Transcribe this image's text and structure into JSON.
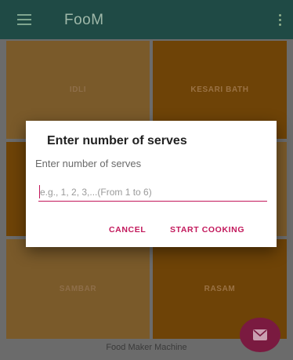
{
  "app_bar": {
    "title": "FooM",
    "menu_icon": "menu-icon",
    "overflow_icon": "overflow-icon"
  },
  "tiles": [
    {
      "label": "IDLI"
    },
    {
      "label": "KESARI BATH"
    },
    {
      "label": ""
    },
    {
      "label": ""
    },
    {
      "label": "SAMBAR"
    },
    {
      "label": "RASAM"
    }
  ],
  "bottom_bar": {
    "label": "Food Maker Machine"
  },
  "fab": {
    "icon": "message-icon"
  },
  "dialog": {
    "title": "Enter number of serves",
    "message": "Enter number of serves",
    "input": {
      "value": "",
      "placeholder": "e.g., 1, 2, 3,...(From 1 to 6)"
    },
    "cancel_label": "CANCEL",
    "start_label": "START COOKING"
  },
  "colors": {
    "app_bar": "#1f4a45",
    "accent": "#c2185b",
    "fab": "#7a1a40",
    "tile_dark": "#6e4307",
    "tile_light": "#7a5a2a"
  }
}
